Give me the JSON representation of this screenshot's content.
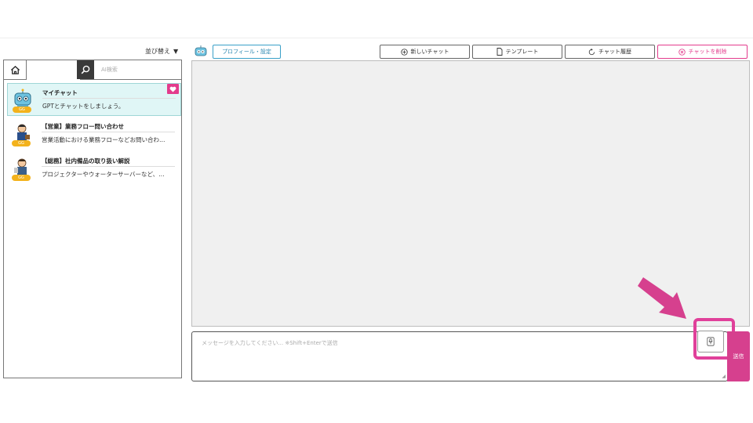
{
  "sidebar": {
    "sort_label": "並び替え",
    "search_placeholder": "",
    "ai_search_label": "AI検索",
    "chats": [
      {
        "title": "マイチャット",
        "desc": "GPTとチャットをしましょう。",
        "badge": "GG",
        "active": true,
        "favorite": true
      },
      {
        "title": "【営業】業務フロー問い合わせ",
        "desc": "営業活動における業務フローなどお問い合わ…",
        "badge": "GG",
        "active": false,
        "favorite": false
      },
      {
        "title": "【総務】社内備品の取り扱い解説",
        "desc": "プロジェクターやウォーターサーバーなど、…",
        "badge": "GG",
        "active": false,
        "favorite": false
      }
    ]
  },
  "header": {
    "profile_label": "プロフィール・設定",
    "new_chat_label": "新しいチャット",
    "template_label": "テンプレート",
    "history_label": "チャット履歴",
    "delete_label": "チャットを削除"
  },
  "composer": {
    "placeholder": "メッセージを入力してください...  ※Shift+Enterで送信",
    "send_label": "送信"
  },
  "colors": {
    "accent": "#d6408e",
    "highlight": "#e0409a",
    "active_item": "#e0f6f6",
    "profile_border": "#3aa0c8"
  }
}
